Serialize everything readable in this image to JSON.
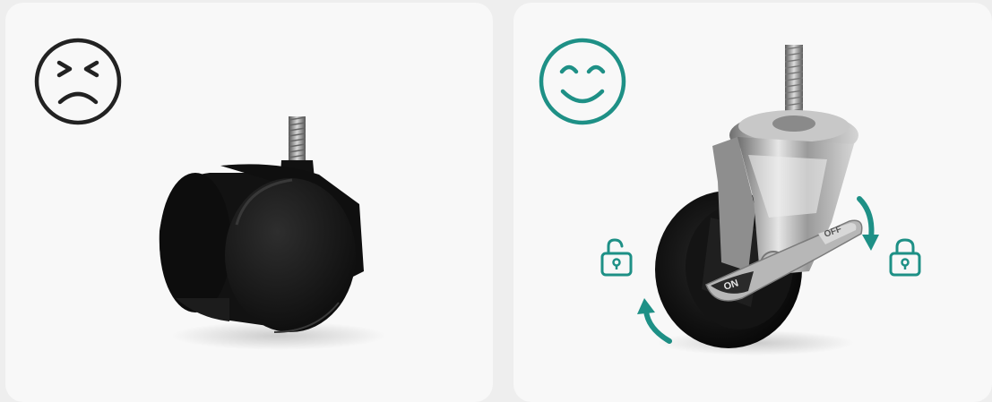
{
  "comparison": {
    "bad": {
      "face_icon": "sad-face-icon",
      "product_icon": "plastic-twin-wheel-caster"
    },
    "good": {
      "face_icon": "smile-face-icon",
      "product_icon": "metal-swivel-caster-with-brake",
      "brake_on_label": "ON",
      "brake_off_label": "OFF",
      "lock_icons": [
        "unlocked-padlock-icon",
        "locked-padlock-icon"
      ],
      "rotation_icons": [
        "rotate-down-arrow-icon",
        "rotate-up-arrow-icon"
      ]
    }
  },
  "colors": {
    "bad_accent": "#222222",
    "good_accent": "#1e9086"
  }
}
